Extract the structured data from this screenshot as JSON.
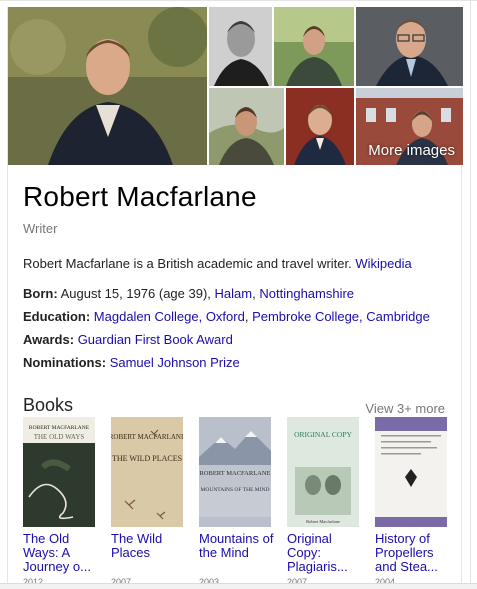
{
  "images": {
    "more_label": "More images"
  },
  "entity": {
    "name": "Robert Macfarlane",
    "type": "Writer",
    "description": "Robert Macfarlane is a British academic and travel writer.",
    "source_link": "Wikipedia"
  },
  "facts": {
    "born": {
      "label": "Born:",
      "value": "August 15, 1976 (age 39),",
      "link1": "Halam",
      "sep": ",",
      "link2": "Nottinghamshire"
    },
    "education": {
      "label": "Education:",
      "link1": "Magdalen College, Oxford",
      "sep": ",",
      "link2": "Pembroke College, Cambridge"
    },
    "awards": {
      "label": "Awards:",
      "link1": "Guardian First Book Award"
    },
    "nominations": {
      "label": "Nominations:",
      "link1": "Samuel Johnson Prize"
    }
  },
  "books": {
    "heading": "Books",
    "view_more": "View 3+ more",
    "items": [
      {
        "title": "The Old Ways: A Journey o...",
        "year": "2012",
        "cover_author": "ROBERT MACFARLANE",
        "cover_title": "THE OLD WAYS"
      },
      {
        "title": "The Wild Places",
        "year": "2007",
        "cover_author": "ROBERT MACFARLANE",
        "cover_title": "THE WILD PLACES"
      },
      {
        "title": "Mountains of the Mind",
        "year": "2003",
        "cover_author": "ROBERT MACFARLANE",
        "cover_title": "MOUNTAINS OF THE MIND"
      },
      {
        "title": "Original Copy: Plagiaris...",
        "year": "2007",
        "cover_title": "ORIGINAL COPY",
        "cover_author": "Robert Macfarlane"
      },
      {
        "title": "History of Propellers and Stea...",
        "year": "2004"
      }
    ]
  },
  "colors": {
    "link": "#1a0dab",
    "muted": "#777777"
  }
}
